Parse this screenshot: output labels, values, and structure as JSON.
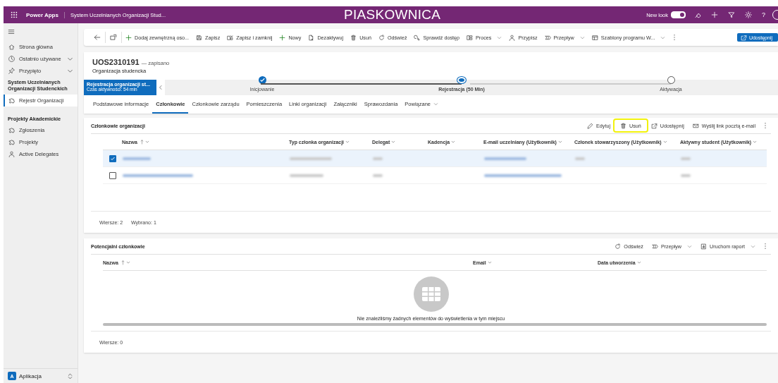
{
  "topbar": {
    "product": "Power Apps",
    "app_name": "System Uczelnianych Organizacji Stud...",
    "environment": "PIASKOWNICA",
    "new_look": {
      "label": "New look",
      "on": true
    },
    "help": "?"
  },
  "sidebar": {
    "items": [
      {
        "label": "Strona główna",
        "expandable": false
      },
      {
        "label": "Ostatnio używane",
        "expandable": true
      },
      {
        "label": "Przypięto",
        "expandable": true
      }
    ],
    "groups": [
      {
        "title": "System Uczelnianych Organizacji Studenckich",
        "items": [
          {
            "label": "Rejestr Organizacji",
            "selected": true
          }
        ]
      },
      {
        "title": "Projekty Akademickie",
        "items": [
          {
            "label": "Zgłoszenia",
            "selected": false
          },
          {
            "label": "Projekty",
            "selected": false
          },
          {
            "label": "Active Delegates",
            "selected": false
          }
        ]
      }
    ],
    "area": {
      "badge": "A",
      "label": "Aplikacja"
    }
  },
  "commands": [
    {
      "label": "Dodaj zewnętrzną oso...",
      "dropdown": false
    },
    {
      "label": "Zapisz",
      "dropdown": false
    },
    {
      "label": "Zapisz i zamknij",
      "dropdown": false
    },
    {
      "label": "Nowy",
      "dropdown": false
    },
    {
      "label": "Dezaktywuj",
      "dropdown": false
    },
    {
      "label": "Usuń",
      "dropdown": false
    },
    {
      "label": "Odśwież",
      "dropdown": false
    },
    {
      "label": "Sprawdź dostęp",
      "dropdown": false
    },
    {
      "label": "Proces",
      "dropdown": true
    },
    {
      "label": "Przypisz",
      "dropdown": false
    },
    {
      "label": "Przepływ",
      "dropdown": true
    },
    {
      "label": "Szablony programu W...",
      "dropdown": true
    }
  ],
  "share_button": {
    "label": "Udostępnij"
  },
  "record": {
    "title": "UOS2310191",
    "status": "— zapisano",
    "entity": "Organizacja studencka"
  },
  "process": {
    "active_stage": {
      "name": "Rejestracja organizacji st...",
      "time": "Czas aktywności: 54 min"
    },
    "stages": [
      {
        "label": "Inicjowanie",
        "done": true,
        "active": false
      },
      {
        "label": "Rejestracja  (50 Min)",
        "done": false,
        "active": true
      },
      {
        "label": "Aktywacja",
        "done": false,
        "active": false
      }
    ]
  },
  "tabs": [
    {
      "label": "Podstawowe informacje",
      "selected": false,
      "dropdown": false
    },
    {
      "label": "Członkowie",
      "selected": true,
      "dropdown": false
    },
    {
      "label": "Członkowie zarządu",
      "selected": false,
      "dropdown": false
    },
    {
      "label": "Pomieszczenia",
      "selected": false,
      "dropdown": false
    },
    {
      "label": "Linki organizacji",
      "selected": false,
      "dropdown": false
    },
    {
      "label": "Załączniki",
      "selected": false,
      "dropdown": false
    },
    {
      "label": "Sprawozdania",
      "selected": false,
      "dropdown": false
    },
    {
      "label": "Powiązane",
      "selected": false,
      "dropdown": true
    }
  ],
  "members": {
    "title": "Członkowie organizacji",
    "actions": [
      {
        "label": "Edytuj",
        "highlighted": false,
        "dropdown": false
      },
      {
        "label": "Usuń",
        "highlighted": true,
        "dropdown": false
      },
      {
        "label": "Udostępnij",
        "highlighted": false,
        "dropdown": false
      },
      {
        "label": "Wyślij link pocztą e-mail",
        "highlighted": false,
        "dropdown": false
      }
    ],
    "columns": [
      {
        "label": "Nazwa",
        "sorted": true
      },
      {
        "label": "Typ członka organizacji",
        "sorted": false
      },
      {
        "label": "Delegat",
        "sorted": false
      },
      {
        "label": "Kadencja",
        "sorted": false
      },
      {
        "label": "E-mail uczelniany  (Użytkownik)",
        "sorted": false
      },
      {
        "label": "Członek stowarzyszony (Użytkownik)",
        "sorted": false
      },
      {
        "label": "Aktywny student (Użytkownik)",
        "sorted": false
      }
    ],
    "rows": [
      {
        "selected": true,
        "cells": [
          {
            "kind": "link"
          },
          {
            "kind": "text"
          },
          {
            "kind": "text"
          },
          {
            "kind": "empty"
          },
          {
            "kind": "link"
          },
          {
            "kind": "text"
          },
          {
            "kind": "text"
          }
        ]
      },
      {
        "selected": false,
        "cells": [
          {
            "kind": "link"
          },
          {
            "kind": "text"
          },
          {
            "kind": "text"
          },
          {
            "kind": "empty"
          },
          {
            "kind": "link"
          },
          {
            "kind": "empty"
          },
          {
            "kind": "text"
          }
        ]
      }
    ],
    "footer": [
      "Wiersze: 2",
      "Wybrano: 1"
    ]
  },
  "potential": {
    "title": "Potencjalni członkowie",
    "actions": [
      {
        "label": "Odśwież",
        "highlighted": false,
        "dropdown": false
      },
      {
        "label": "Przepływ",
        "highlighted": false,
        "dropdown": true
      },
      {
        "label": "Uruchom raport",
        "highlighted": false,
        "dropdown": true
      }
    ],
    "columns": [
      {
        "label": "Nazwa",
        "sorted": true
      },
      {
        "label": "Email",
        "sorted": false
      },
      {
        "label": "Data utworzenia",
        "sorted": false
      }
    ],
    "empty_message": "Nie znaleźliśmy żadnych elementów do wyświetlenia w tym miejscu",
    "footer": [
      "Wiersze: 0"
    ]
  }
}
